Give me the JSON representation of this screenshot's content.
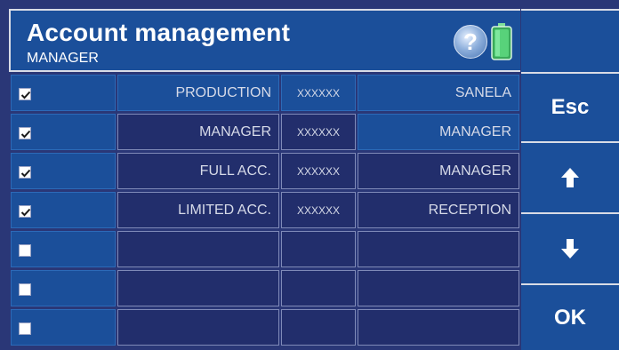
{
  "header": {
    "title": "Account management",
    "subtitle": "MANAGER",
    "help_label": "?"
  },
  "accounts": [
    {
      "checked": true,
      "name": "PRODUCTION",
      "password": "XXXXXX",
      "role": "SANELA"
    },
    {
      "checked": true,
      "name": "MANAGER",
      "password": "XXXXXX",
      "role": "MANAGER"
    },
    {
      "checked": true,
      "name": "FULL ACC.",
      "password": "XXXXXX",
      "role": "MANAGER"
    },
    {
      "checked": true,
      "name": "LIMITED ACC.",
      "password": "XXXXXX",
      "role": "RECEPTION"
    },
    {
      "checked": false,
      "name": "",
      "password": "",
      "role": ""
    },
    {
      "checked": false,
      "name": "",
      "password": "",
      "role": ""
    },
    {
      "checked": false,
      "name": "",
      "password": "",
      "role": ""
    }
  ],
  "side": {
    "esc_label": "Esc",
    "up_icon": "arrow-up-icon",
    "down_icon": "arrow-down-icon",
    "ok_label": "OK"
  },
  "colors": {
    "background": "#2a3777",
    "header_blue": "#1b4f9a",
    "cell_dark": "#222e6c",
    "text_light": "#d6dae8",
    "battery_green": "#48c46a"
  }
}
